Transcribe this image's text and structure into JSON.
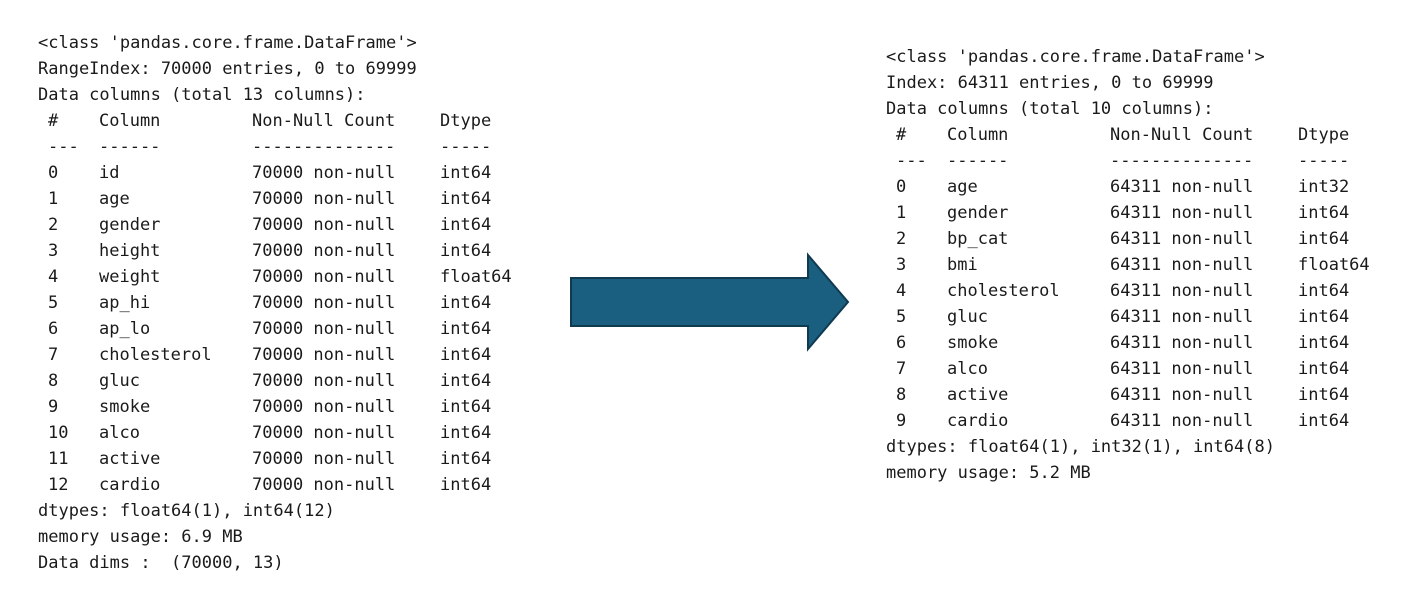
{
  "left": {
    "class_line": "<class 'pandas.core.frame.DataFrame'>",
    "index_line": "RangeIndex: 70000 entries, 0 to 69999",
    "columns_line": "Data columns (total 13 columns):",
    "headers": [
      "#",
      "Column",
      "Non-Null Count",
      "Dtype"
    ],
    "separators": [
      "---",
      "------",
      "--------------",
      "-----"
    ],
    "rows": [
      [
        "0",
        "id",
        "70000 non-null",
        "int64"
      ],
      [
        "1",
        "age",
        "70000 non-null",
        "int64"
      ],
      [
        "2",
        "gender",
        "70000 non-null",
        "int64"
      ],
      [
        "3",
        "height",
        "70000 non-null",
        "int64"
      ],
      [
        "4",
        "weight",
        "70000 non-null",
        "float64"
      ],
      [
        "5",
        "ap_hi",
        "70000 non-null",
        "int64"
      ],
      [
        "6",
        "ap_lo",
        "70000 non-null",
        "int64"
      ],
      [
        "7",
        "cholesterol",
        "70000 non-null",
        "int64"
      ],
      [
        "8",
        "gluc",
        "70000 non-null",
        "int64"
      ],
      [
        "9",
        "smoke",
        "70000 non-null",
        "int64"
      ],
      [
        "10",
        "alco",
        "70000 non-null",
        "int64"
      ],
      [
        "11",
        "active",
        "70000 non-null",
        "int64"
      ],
      [
        "12",
        "cardio",
        "70000 non-null",
        "int64"
      ]
    ],
    "dtypes_line": "dtypes: float64(1), int64(12)",
    "memory_line": "memory usage: 6.9 MB",
    "dims_line": "Data dims :  (70000, 13)"
  },
  "right": {
    "class_line": "<class 'pandas.core.frame.DataFrame'>",
    "index_line": "Index: 64311 entries, 0 to 69999",
    "columns_line": "Data columns (total 10 columns):",
    "headers": [
      "#",
      "Column",
      "Non-Null Count",
      "Dtype"
    ],
    "separators": [
      "---",
      "------",
      "--------------",
      "-----"
    ],
    "rows": [
      [
        "0",
        "age",
        "64311 non-null",
        "int32"
      ],
      [
        "1",
        "gender",
        "64311 non-null",
        "int64"
      ],
      [
        "2",
        "bp_cat",
        "64311 non-null",
        "int64"
      ],
      [
        "3",
        "bmi",
        "64311 non-null",
        "float64"
      ],
      [
        "4",
        "cholesterol",
        "64311 non-null",
        "int64"
      ],
      [
        "5",
        "gluc",
        "64311 non-null",
        "int64"
      ],
      [
        "6",
        "smoke",
        "64311 non-null",
        "int64"
      ],
      [
        "7",
        "alco",
        "64311 non-null",
        "int64"
      ],
      [
        "8",
        "active",
        "64311 non-null",
        "int64"
      ],
      [
        "9",
        "cardio",
        "64311 non-null",
        "int64"
      ]
    ],
    "dtypes_line": "dtypes: float64(1), int32(1), int64(8)",
    "memory_line": "memory usage: 5.2 MB"
  },
  "arrow": {
    "icon": "right-arrow-icon",
    "fill": "#1b5f80",
    "stroke": "#0f3a50"
  }
}
